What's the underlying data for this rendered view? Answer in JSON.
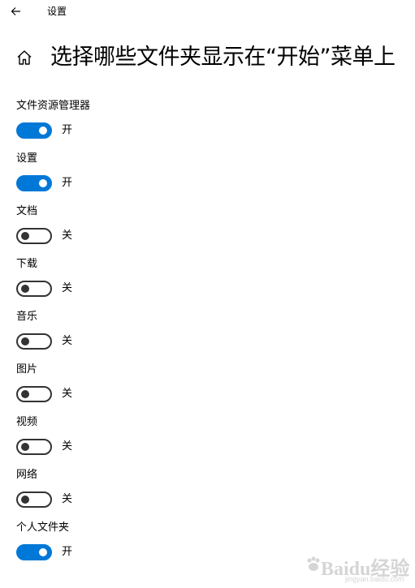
{
  "window": {
    "title": "设置",
    "back_icon": "arrow-left-icon"
  },
  "header": {
    "home_icon": "home-icon",
    "title": "选择哪些文件夹显示在“开始”菜单上"
  },
  "colors": {
    "accent": "#0078d7",
    "off_border": "#333333"
  },
  "settings": [
    {
      "label": "文件资源管理器",
      "on": true,
      "state": "开"
    },
    {
      "label": "设置",
      "on": true,
      "state": "开"
    },
    {
      "label": "文档",
      "on": false,
      "state": "关"
    },
    {
      "label": "下载",
      "on": false,
      "state": "关"
    },
    {
      "label": "音乐",
      "on": false,
      "state": "关"
    },
    {
      "label": "图片",
      "on": false,
      "state": "关"
    },
    {
      "label": "视频",
      "on": false,
      "state": "关"
    },
    {
      "label": "网络",
      "on": false,
      "state": "关"
    },
    {
      "label": "个人文件夹",
      "on": true,
      "state": "开"
    }
  ],
  "watermark": {
    "text": "Baidu经验",
    "url": "jingyan.baidu.com"
  }
}
